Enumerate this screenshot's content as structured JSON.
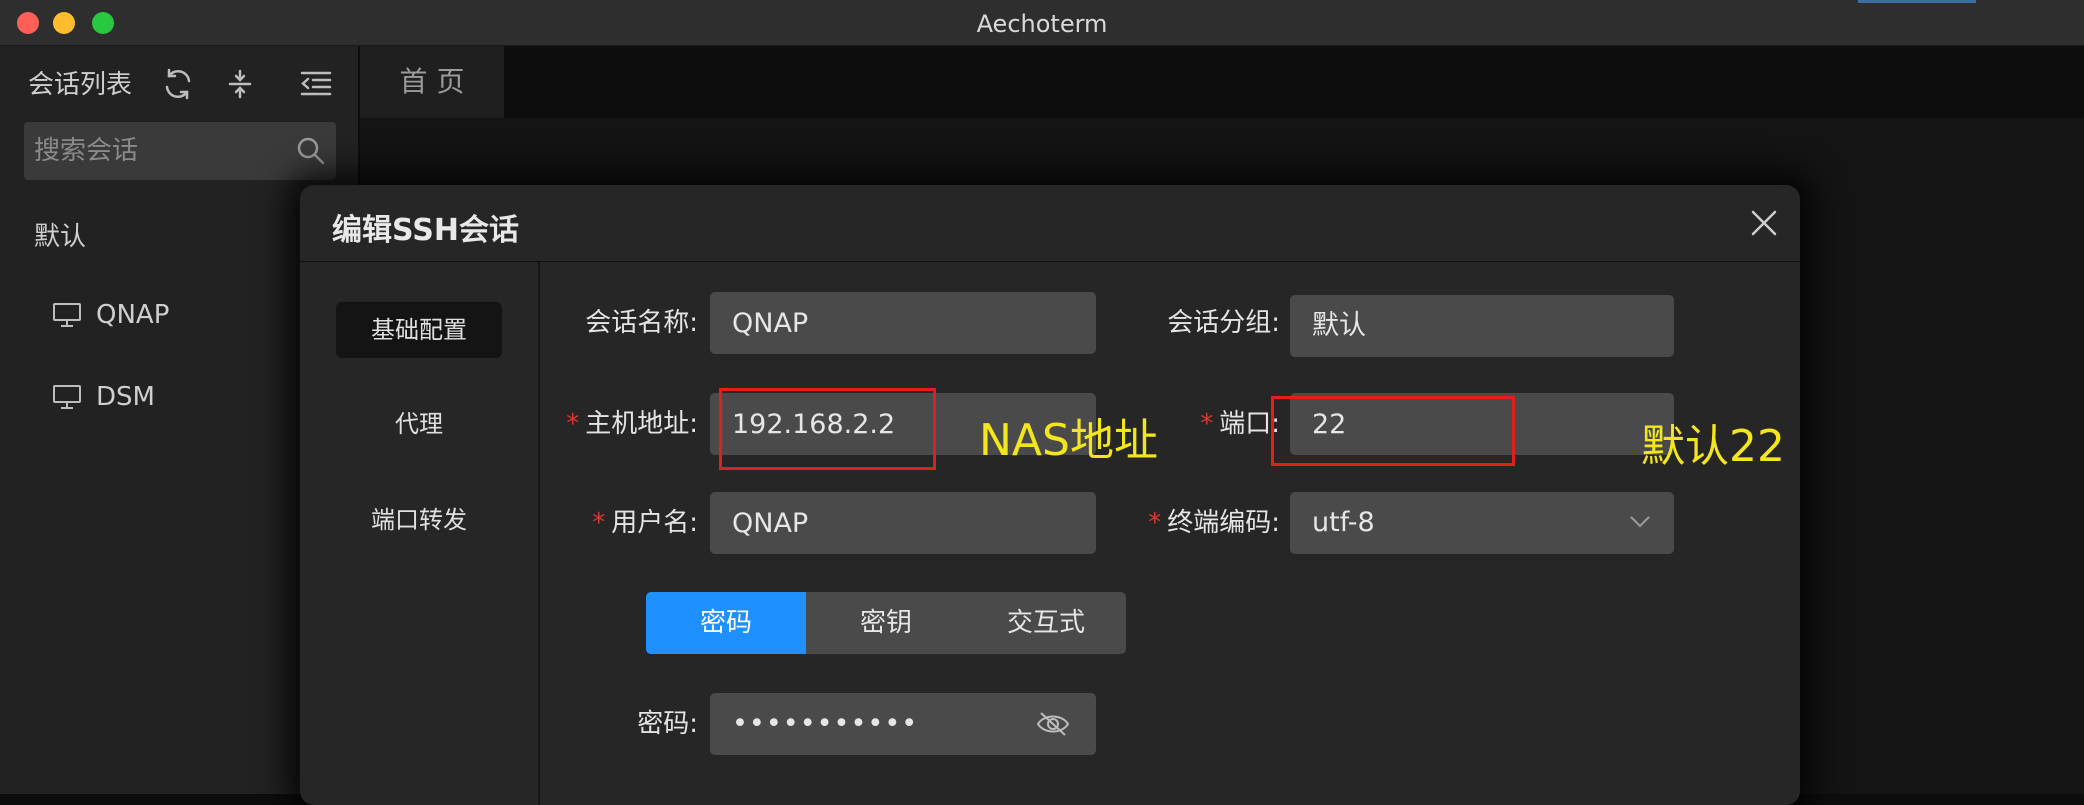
{
  "window": {
    "title": "Aechoterm",
    "traffic_lights": [
      "#fe5f57",
      "#febc2e",
      "#28c840"
    ]
  },
  "sidebar": {
    "title": "会话列表",
    "search_placeholder": "搜索会话",
    "group": "默认",
    "sessions": [
      {
        "name": "QNAP"
      },
      {
        "name": "DSM"
      }
    ]
  },
  "tabs": {
    "home": "首 页"
  },
  "dialog": {
    "title": "编辑SSH会话",
    "nav": [
      "基础配置",
      "代理",
      "端口转发"
    ],
    "fields": {
      "session_name": {
        "label": "会话名称:",
        "value": "QNAP"
      },
      "session_group": {
        "label": "会话分组:",
        "value": "默认"
      },
      "host": {
        "label": "主机地址:",
        "value": "192.168.2.2"
      },
      "port": {
        "label": "端口:",
        "value": "22"
      },
      "username": {
        "label": "用户名:",
        "value": "QNAP"
      },
      "encoding": {
        "label": "终端编码:",
        "value": "utf-8"
      },
      "password": {
        "label": "密码:",
        "value": "•••••••••••"
      }
    },
    "required_mark": "*",
    "auth_tabs": [
      "密码",
      "密钥",
      "交互式"
    ],
    "active_auth_tab": "密码"
  },
  "annotations": {
    "host_note": "NAS地址",
    "port_note": "默认22",
    "color": "#f4e61d"
  },
  "colors": {
    "accent": "#1e90ff",
    "required": "#e2352f",
    "highlight_box": "#e0201c"
  }
}
